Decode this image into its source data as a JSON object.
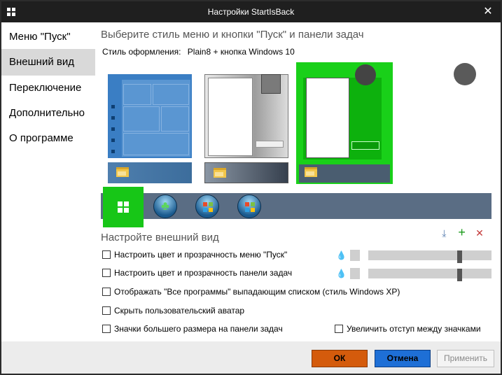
{
  "window": {
    "title": "Настройки StartIsBack",
    "close_glyph": "✕"
  },
  "sidebar": {
    "items": [
      {
        "label": "Меню \"Пуск\"",
        "active": false
      },
      {
        "label": "Внешний вид",
        "active": true
      },
      {
        "label": "Переключение",
        "active": false
      },
      {
        "label": "Дополнительно",
        "active": false
      },
      {
        "label": "О программе",
        "active": false
      }
    ]
  },
  "appearance": {
    "heading": "Выберите стиль меню и кнопки \"Пуск\" и панели задач",
    "style_label": "Стиль оформления:",
    "style_value": "Plain8 + кнопка Windows 10",
    "selected_theme_index": 2,
    "selected_orb_index": 0,
    "orbs": [
      "windows-10-logo-icon",
      "clover-orb-icon",
      "windows-7-orb-icon",
      "windows-vista-orb-icon"
    ],
    "accent_color": "#19d019"
  },
  "customize": {
    "title": "Настройте внешний вид",
    "icons": [
      "download-icon",
      "plus-icon",
      "close-icon"
    ],
    "options": [
      {
        "label": "Настроить цвет и прозрачность меню \"Пуск\"",
        "checked": false
      },
      {
        "label": "Настроить цвет и прозрачность панели задач",
        "checked": false
      },
      {
        "label": "Отображать \"Все программы\" выпадающим списком (стиль Windows XP)",
        "checked": false
      },
      {
        "label": "Скрыть пользовательский аватар",
        "checked": false
      },
      {
        "label": "Значки большего размера на панели задач",
        "checked": false
      },
      {
        "label": "Увеличить отступ между значками",
        "checked": false
      }
    ],
    "menu_transparency_level": 0.75,
    "taskbar_transparency_level": 0.75
  },
  "footer": {
    "ok_label": "ОК",
    "cancel_label": "Отмена",
    "apply_label": "Применить",
    "ok_color": "#d45b0c",
    "cancel_color": "#1e6fd6"
  }
}
